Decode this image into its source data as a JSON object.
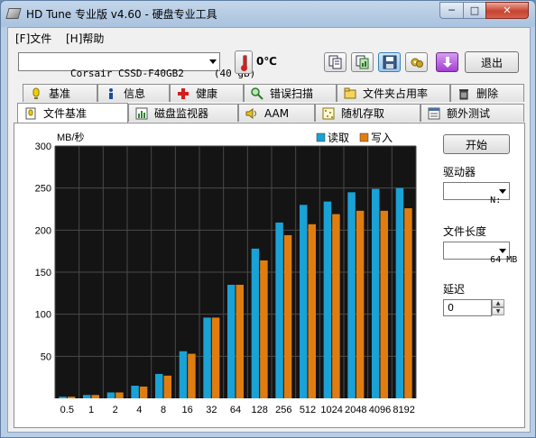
{
  "window": {
    "title": "HD Tune 专业版 v4.60 - 硬盘专业工具",
    "minimize_glyph": "─",
    "maximize_glyph": "□",
    "close_glyph": "✕"
  },
  "menu": {
    "items": [
      {
        "label": "[F]文件"
      },
      {
        "label": "[H]帮助"
      }
    ]
  },
  "toolbar": {
    "drive": "Corsair CSSD-F40GB2     (40 gB)",
    "temperature": "0℃",
    "exit_label": "退出",
    "icons": [
      "copy-text-icon",
      "copy-screenshot-icon",
      "save-icon",
      "options-icon",
      "download-icon"
    ]
  },
  "tabs": {
    "row1": [
      {
        "label": "基准",
        "icon": "benchmark-icon"
      },
      {
        "label": "信息",
        "icon": "info-icon"
      },
      {
        "label": "健康",
        "icon": "health-icon"
      },
      {
        "label": "错误扫描",
        "icon": "error-scan-icon"
      },
      {
        "label": "文件夹占用率",
        "icon": "folder-usage-icon"
      },
      {
        "label": "删除",
        "icon": "erase-icon"
      }
    ],
    "row2": [
      {
        "label": "文件基准",
        "icon": "file-benchmark-icon",
        "selected": true
      },
      {
        "label": "磁盘监视器",
        "icon": "disk-monitor-icon"
      },
      {
        "label": "AAM",
        "icon": "speaker-icon"
      },
      {
        "label": "随机存取",
        "icon": "random-access-icon"
      },
      {
        "label": "额外测试",
        "icon": "extra-tests-icon"
      }
    ]
  },
  "side_panel": {
    "start_label": "开始",
    "drive_label": "驱动器",
    "drive_value": "N:",
    "file_length_label": "文件长度",
    "file_length_value": "64 MB",
    "delay_label": "延迟",
    "delay_value": "0"
  },
  "colors": {
    "read": "#1aa2d6",
    "write": "#e07d10",
    "plot_bg": "#141414",
    "grid": "#4a4a4a"
  },
  "chart_data": {
    "type": "bar",
    "ylabel": "MB/秒",
    "ylim": [
      0,
      300
    ],
    "yticks": [
      50,
      100,
      150,
      200,
      250,
      300
    ],
    "categories": [
      "0.5",
      "1",
      "2",
      "4",
      "8",
      "16",
      "32",
      "64",
      "128",
      "256",
      "512",
      "1024",
      "2048",
      "4096",
      "8192"
    ],
    "series": [
      {
        "name": "读取",
        "values": [
          2,
          4,
          7,
          15,
          29,
          56,
          96,
          135,
          178,
          209,
          230,
          234,
          245,
          249,
          250
        ]
      },
      {
        "name": "写入",
        "values": [
          2,
          4,
          7,
          14,
          27,
          53,
          96,
          135,
          164,
          194,
          207,
          219,
          223,
          223,
          226
        ]
      }
    ],
    "legend_position": "top-right",
    "grid": true
  }
}
